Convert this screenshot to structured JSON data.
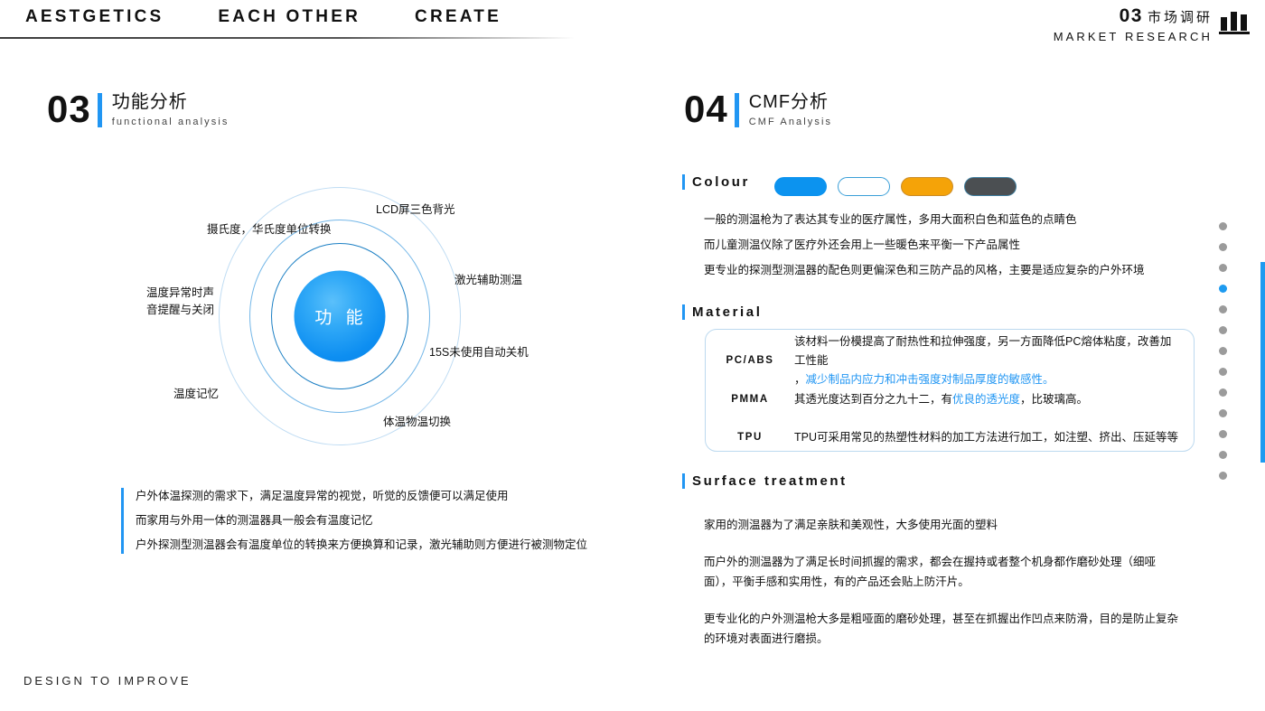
{
  "header": {
    "nav": [
      "AESTGETICS",
      "EACH OTHER",
      "CREATE"
    ],
    "brand_number": "03",
    "brand_cn": "市场调研",
    "brand_en": "MARKET RESEARCH",
    "icon": "bar-chart-icon"
  },
  "left": {
    "section": {
      "number": "03",
      "title_cn": "功能分析",
      "title_en": "functional analysis"
    },
    "diagram": {
      "center_label": "功 能",
      "labels": [
        "LCD屏三色背光",
        "摄氏度，华氏度单位转换",
        "激光辅助测温",
        "温度异常时声",
        "音提醒与关闭",
        "15S未使用自动关机",
        "温度记忆",
        "体温物温切换"
      ]
    },
    "note": [
      "户外体温探测的需求下，满足温度异常的视觉，听觉的反馈便可以满足使用",
      "而家用与外用一体的测温器具一般会有温度记忆",
      "户外探测型测温器会有温度单位的转换来方便换算和记录，激光辅助则方便进行被测物定位"
    ]
  },
  "right": {
    "section": {
      "number": "04",
      "title_cn": "CMF分析",
      "title_en": "CMF Analysis"
    },
    "colour": {
      "title": "Colour",
      "swatches": [
        {
          "name": "blue-swatch",
          "fill": "#0c93ef",
          "border": "#0c93ef"
        },
        {
          "name": "white-swatch",
          "fill": "#ffffff",
          "border": "#3a9fd8"
        },
        {
          "name": "orange-swatch",
          "fill": "#f5a308",
          "border": "#c98c2a"
        },
        {
          "name": "dark-gray-swatch",
          "fill": "#4b4f52",
          "border": "#3f7fa0"
        }
      ],
      "lines": [
        "一般的测温枪为了表达其专业的医疗属性，多用大面积白色和蓝色的点睛色",
        "而儿童测温仪除了医疗外还会用上一些暖色来平衡一下产品属性",
        "更专业的探测型测温器的配色则更偏深色和三防产品的风格，主要是适应复杂的户外环境"
      ]
    },
    "material": {
      "title": "Material",
      "rows": [
        {
          "key": "PC/ABS",
          "text_1": "该材料一份模提高了耐热性和拉伸强度，另一方面降低PC熔体粘度，改善加工性能",
          "text_2_prefix": "，",
          "text_2_highlight": "减少制品内应力和冲击强度对制品厚度的敏感性。"
        },
        {
          "key": "PMMA",
          "text_1": "其透光度达到百分之九十二，有",
          "text_highlight": "优良的透光度",
          "text_2": "，比玻璃高。"
        },
        {
          "key": "TPU",
          "text_1": "TPU可采用常见的热塑性材料的加工方法进行加工，如注塑、挤出、压延等等"
        }
      ]
    },
    "surface": {
      "title": "Surface treatment",
      "paragraphs": [
        "家用的测温器为了满足亲肤和美观性，大多使用光面的塑料",
        "而户外的测温器为了满足长时间抓握的需求，都会在握持或者整个机身都作磨砂处理（细哑面），平衡手感和实用性，有的产品还会贴上防汗片。",
        "更专业化的户外测温枪大多是粗哑面的磨砂处理，甚至在抓握出作凹点来防滑，目的是防止复杂的环境对表面进行磨损。"
      ]
    }
  },
  "rail": {
    "dot_count": 13,
    "active_index": 3,
    "active_color": "#1e9bf0",
    "inactive_color": "#9b9b9b"
  },
  "footer": {
    "text": "DESIGN TO IMPROVE"
  }
}
